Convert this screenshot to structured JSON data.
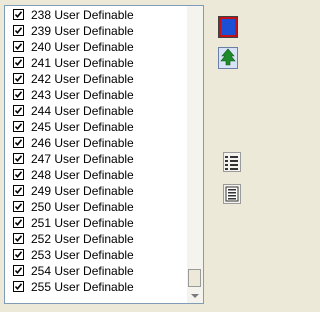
{
  "list": {
    "items": [
      {
        "label": "238 User Definable",
        "checked": true
      },
      {
        "label": "239 User Definable",
        "checked": true
      },
      {
        "label": "240 User Definable",
        "checked": true
      },
      {
        "label": "241 User Definable",
        "checked": true
      },
      {
        "label": "242 User Definable",
        "checked": true
      },
      {
        "label": "243 User Definable",
        "checked": true
      },
      {
        "label": "244 User Definable",
        "checked": true
      },
      {
        "label": "245 User Definable",
        "checked": true
      },
      {
        "label": "246 User Definable",
        "checked": true
      },
      {
        "label": "247 User Definable",
        "checked": true
      },
      {
        "label": "248 User Definable",
        "checked": true
      },
      {
        "label": "249 User Definable",
        "checked": true
      },
      {
        "label": "250 User Definable",
        "checked": true
      },
      {
        "label": "251 User Definable",
        "checked": true
      },
      {
        "label": "252 User Definable",
        "checked": true
      },
      {
        "label": "253 User Definable",
        "checked": true
      },
      {
        "label": "254 User Definable",
        "checked": true
      },
      {
        "label": "255 User Definable",
        "checked": true
      }
    ]
  },
  "toolbar": {
    "color_icon": "color-swatch-icon",
    "tree_icon": "tree-icon",
    "check_all_icon": "checklist-icon",
    "list_icon": "list-icon"
  },
  "colors": {
    "swatch_blue": "#1b4fd6",
    "swatch_red": "#c1121a",
    "tree_green": "#1e8a2a",
    "list_border": "#7f9db9"
  }
}
